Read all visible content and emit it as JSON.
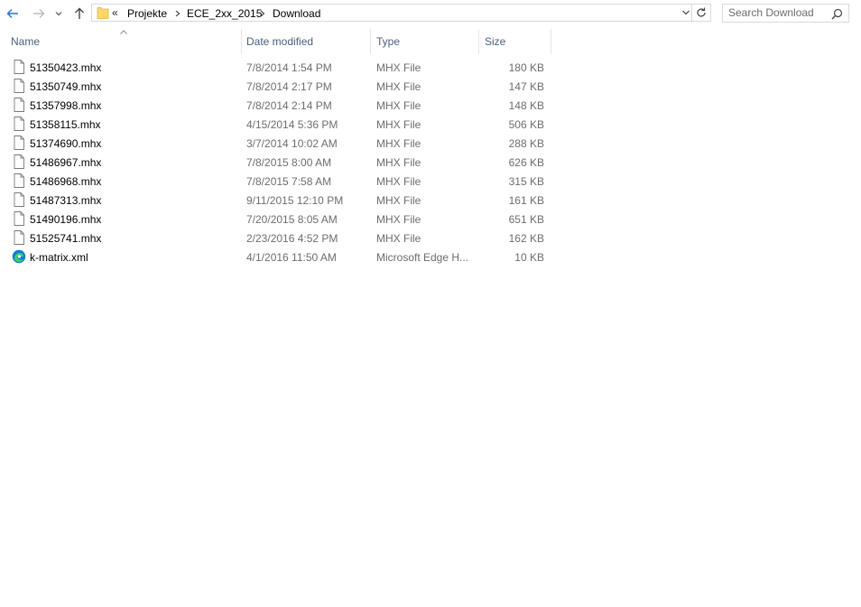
{
  "nav": {
    "back_icon": "arrow-left-icon",
    "forward_icon": "arrow-right-icon",
    "recent_icon": "chevron-down-icon",
    "up_icon": "arrow-up-icon"
  },
  "address": {
    "overflow_chevron": "«",
    "breadcrumbs": [
      "Projekte",
      "ECE_2xx_2015",
      "Download"
    ],
    "dropdown_icon": "chevron-down-icon",
    "refresh_icon": "refresh-icon"
  },
  "search": {
    "placeholder": "Search Download",
    "icon": "search-icon"
  },
  "columns": {
    "name": "Name",
    "date": "Date modified",
    "type": "Type",
    "size": "Size"
  },
  "files": [
    {
      "name": "51350423.mhx",
      "date": "7/8/2014 1:54 PM",
      "type": "MHX File",
      "size": "180 KB",
      "icon": "document-icon"
    },
    {
      "name": "51350749.mhx",
      "date": "7/8/2014 2:17 PM",
      "type": "MHX File",
      "size": "147 KB",
      "icon": "document-icon"
    },
    {
      "name": "51357998.mhx",
      "date": "7/8/2014 2:14 PM",
      "type": "MHX File",
      "size": "148 KB",
      "icon": "document-icon"
    },
    {
      "name": "51358115.mhx",
      "date": "4/15/2014 5:36 PM",
      "type": "MHX File",
      "size": "506 KB",
      "icon": "document-icon"
    },
    {
      "name": "51374690.mhx",
      "date": "3/7/2014 10:02 AM",
      "type": "MHX File",
      "size": "288 KB",
      "icon": "document-icon"
    },
    {
      "name": "51486967.mhx",
      "date": "7/8/2015 8:00 AM",
      "type": "MHX File",
      "size": "626 KB",
      "icon": "document-icon"
    },
    {
      "name": "51486968.mhx",
      "date": "7/8/2015 7:58 AM",
      "type": "MHX File",
      "size": "315 KB",
      "icon": "document-icon"
    },
    {
      "name": "51487313.mhx",
      "date": "9/11/2015 12:10 PM",
      "type": "MHX File",
      "size": "161 KB",
      "icon": "document-icon"
    },
    {
      "name": "51490196.mhx",
      "date": "7/20/2015 8:05 AM",
      "type": "MHX File",
      "size": "651 KB",
      "icon": "document-icon"
    },
    {
      "name": "51525741.mhx",
      "date": "2/23/2016 4:52 PM",
      "type": "MHX File",
      "size": "162 KB",
      "icon": "document-icon"
    },
    {
      "name": "k-matrix.xml",
      "date": "4/1/2016 11:50 AM",
      "type": "Microsoft Edge H...",
      "size": "10 KB",
      "icon": "edge-icon"
    }
  ],
  "colors": {
    "accent": "#1a73e8",
    "header_text": "#4c607a",
    "secondary_text": "#6d6d6d",
    "folder": "#ffd766"
  }
}
